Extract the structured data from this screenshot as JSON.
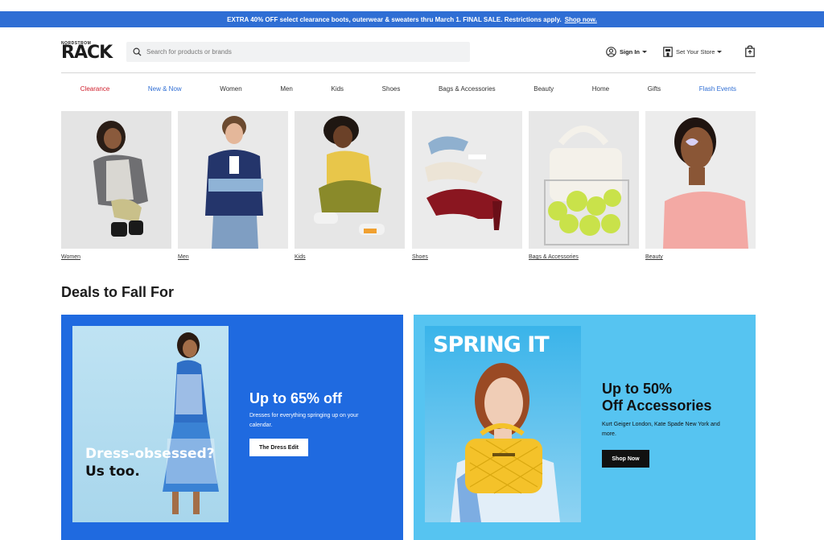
{
  "promo": {
    "text": "EXTRA 40% OFF select clearance boots, outerwear & sweaters thru March 1. FINAL SALE. Restrictions apply.",
    "link": "Shop now."
  },
  "header": {
    "logo_small": "NORDSTROM",
    "logo_big": "RACK",
    "search_placeholder": "Search for products or brands",
    "signin": "Sign In",
    "store": "Set Your Store"
  },
  "nav": [
    "Clearance",
    "New & Now",
    "Women",
    "Men",
    "Kids",
    "Shoes",
    "Bags & Accessories",
    "Beauty",
    "Home",
    "Gifts",
    "Flash Events"
  ],
  "categories": [
    "Women",
    "Men",
    "Kids",
    "Shoes",
    "Bags & Accessories",
    "Beauty"
  ],
  "section_title": "Deals to Fall For",
  "cards": {
    "left": {
      "overlay": "Dress-obsessed? Us too.",
      "overlay_line1": "Dress-obsessed?",
      "overlay_line2": "Us too.",
      "headline": "Up to 65% off",
      "body": "Dresses for everything springing up on your calendar.",
      "button": "The Dress Edit"
    },
    "right": {
      "overlay": "SPRING IT",
      "headline": "Up to 50% Off Accessories",
      "headline_line1": "Up to 50%",
      "headline_line2": "Off Accessories",
      "body": "Kurt Geiger London, Kate Spade New York and more.",
      "button": "Shop Now"
    }
  },
  "colors": {
    "promo_bar": "#2f6ed4",
    "clearance": "#d0202e",
    "accent_blue": "#2f6ed4",
    "card_left_bg": "#1f6ae0",
    "card_right_bg": "#56c4f1"
  }
}
